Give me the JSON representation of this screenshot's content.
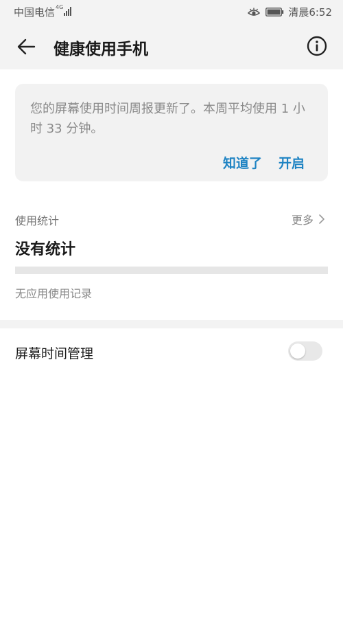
{
  "status_bar": {
    "carrier": "中国电信",
    "network_type": "4G",
    "time": "清晨6:52",
    "icons": [
      "signal-icon",
      "eye-comfort-icon",
      "battery-icon"
    ]
  },
  "header": {
    "title": "健康使用手机",
    "back_icon": "arrow-left-icon",
    "info_icon": "info-circle-icon"
  },
  "notice": {
    "text": "您的屏幕使用时间周报更新了。本周平均使用 1 小时 33 分钟。",
    "dismiss_label": "知道了",
    "enable_label": "开启"
  },
  "usage": {
    "section_label": "使用统计",
    "more_label": "更多",
    "headline": "没有统计",
    "empty_text": "无应用使用记录"
  },
  "settings": {
    "screen_time_label": "屏幕时间管理",
    "screen_time_enabled": false
  },
  "colors": {
    "accent": "#1e83c3",
    "header_bg": "#f3f3f3",
    "card_bg": "#f2f2f2"
  }
}
